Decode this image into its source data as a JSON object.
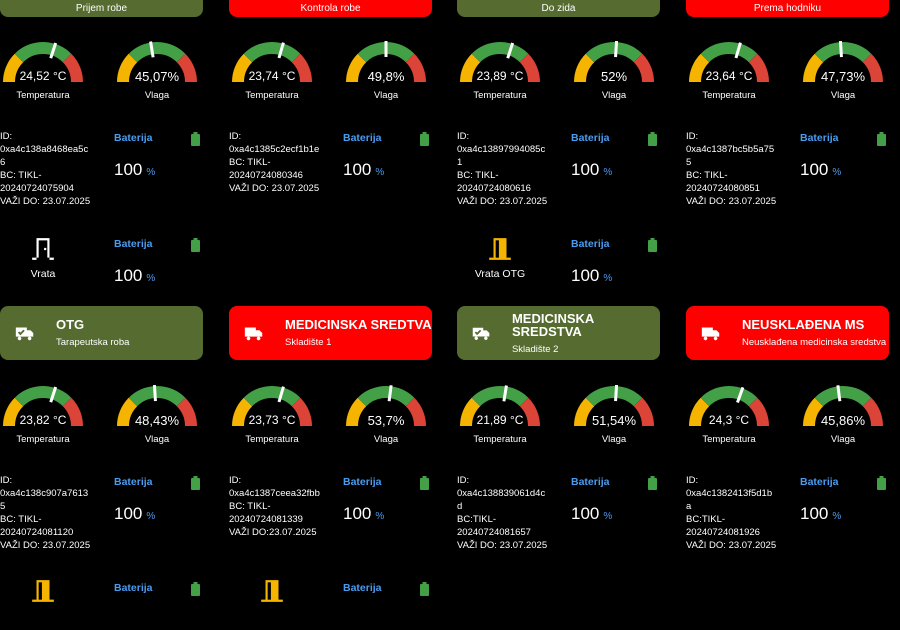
{
  "colors": {
    "green_card": "#556b2f",
    "red_card": "#ff0000",
    "accent_blue": "#4a9cf0",
    "battery_green": "#43a047",
    "door_yellow": "#f4b400"
  },
  "top_row": [
    {
      "color": "green",
      "title": "Prijem robe",
      "temp": "24,52 °C",
      "temp_level": 0.6,
      "hum": "45,07%",
      "hum_level": 0.45,
      "temp_label": "Temperatura",
      "hum_label": "Vlaga",
      "info": [
        "ID:",
        "0xa4c138a8468ea5c",
        "6",
        "BC: TIKL-",
        "20240724075904",
        "VAŽI DO: 23.07.2025"
      ],
      "battery_label": "Baterija",
      "battery": "100",
      "battery_unit": "%",
      "door": {
        "icon": "door-icon",
        "label": "Vrata",
        "color": "#ffffff",
        "battery_label": "Baterija",
        "battery": "100",
        "battery_unit": "%"
      }
    },
    {
      "color": "red",
      "title": "Kontrola robe",
      "temp": "23,74 °C",
      "temp_level": 0.59,
      "hum": "49,8%",
      "hum_level": 0.5,
      "temp_label": "Temperatura",
      "hum_label": "Vlaga",
      "info": [
        "ID:",
        "0xa4c1385c2ecf1b1e",
        "BC: TIKL-",
        "20240724080346",
        "VAŽI DO: 23.07.2025"
      ],
      "battery_label": "Baterija",
      "battery": "100",
      "battery_unit": "%",
      "door": null
    },
    {
      "color": "green",
      "title": "Do zida",
      "temp": "23,89 °C",
      "temp_level": 0.6,
      "hum": "52%",
      "hum_level": 0.52,
      "temp_label": "Temperatura",
      "hum_label": "Vlaga",
      "info": [
        "ID:",
        "0xa4c13897994085c",
        "1",
        "BC: TIKL-",
        "20240724080616",
        "VAŽI DO: 23.07.2025"
      ],
      "battery_label": "Baterija",
      "battery": "100",
      "battery_unit": "%",
      "door": {
        "icon": "door-icon",
        "label": "Vrata OTG",
        "color": "#f4b400",
        "battery_label": "Baterija",
        "battery": "100",
        "battery_unit": "%"
      }
    },
    {
      "color": "red",
      "title": "Prema hodniku",
      "temp": "23,64 °C",
      "temp_level": 0.59,
      "hum": "47,73%",
      "hum_level": 0.48,
      "temp_label": "Temperatura",
      "hum_label": "Vlaga",
      "info": [
        "ID:",
        "0xa4c1387bc5b5a75",
        "5",
        "BC: TIKL-",
        "20240724080851",
        "VAŽI DO: 23.07.2025"
      ],
      "battery_label": "Baterija",
      "battery": "100",
      "battery_unit": "%",
      "door": null
    }
  ],
  "bottom_row": [
    {
      "color": "green",
      "title": "OTG",
      "subtitle": "Tarapeutska roba",
      "icon": "truck-check-icon",
      "temp": "23,82 °C",
      "temp_level": 0.6,
      "hum": "48,43%",
      "hum_level": 0.48,
      "temp_label": "Temperatura",
      "hum_label": "Vlaga",
      "info": [
        "ID:",
        "0xa4c138c907a7613",
        "5",
        "BC: TIKL-",
        "20240724081120",
        "VAŽI DO: 23.07.2025"
      ],
      "battery_label": "Baterija",
      "battery": "100",
      "battery_unit": "%",
      "door": {
        "icon": "door-icon",
        "label": "",
        "color": "#f4b400",
        "battery_label": "Baterija",
        "battery": "",
        "battery_unit": ""
      }
    },
    {
      "color": "red",
      "title": "MEDICINSKA SREDTVA",
      "subtitle": "Skladište 1",
      "icon": "truck-icon",
      "temp": "23,73 °C",
      "temp_level": 0.59,
      "hum": "53,7%",
      "hum_level": 0.54,
      "temp_label": "Temperatura",
      "hum_label": "Vlaga",
      "info": [
        "ID:",
        "0xa4c1387ceea32fbb",
        "BC: TIKL-",
        "20240724081339",
        "VAŽI DO:23.07.2025"
      ],
      "battery_label": "Baterija",
      "battery": "100",
      "battery_unit": "%",
      "door": {
        "icon": "door-icon",
        "label": "",
        "color": "#f4b400",
        "battery_label": "Baterija",
        "battery": "",
        "battery_unit": ""
      }
    },
    {
      "color": "green",
      "title": "MEDICINSKA SREDSTVA",
      "subtitle": "Skladište 2",
      "icon": "truck-check-icon",
      "temp": "21,89 °C",
      "temp_level": 0.55,
      "hum": "51,54%",
      "hum_level": 0.52,
      "temp_label": "Temperatura",
      "hum_label": "Vlaga",
      "info": [
        "ID:",
        "0xa4c138839061d4c",
        "d",
        "BC:TIKL-",
        "20240724081657",
        "VAŽI DO: 23.07.2025"
      ],
      "battery_label": "Baterija",
      "battery": "100",
      "battery_unit": "%",
      "door": null
    },
    {
      "color": "red",
      "title": "NEUSKLAĐENA MS",
      "subtitle": "Neusklađena medicinska sredstva",
      "icon": "truck-icon",
      "temp": "24,3 °C",
      "temp_level": 0.61,
      "hum": "45,86%",
      "hum_level": 0.46,
      "temp_label": "Temperatura",
      "hum_label": "Vlaga",
      "info": [
        "ID:",
        "0xa4c1382413f5d1b",
        "a",
        "BC:TIKL-",
        "20240724081926",
        "VAŽI DO: 23.07.2025"
      ],
      "battery_label": "Baterija",
      "battery": "100",
      "battery_unit": "%",
      "door": null
    }
  ]
}
